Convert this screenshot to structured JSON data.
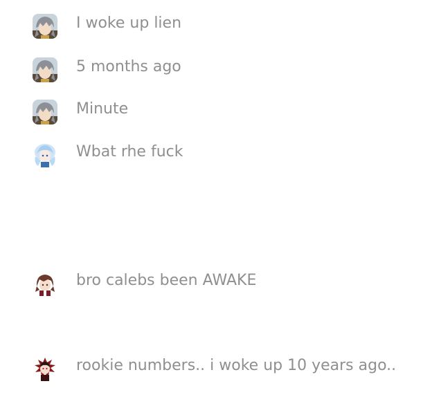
{
  "messages": [
    {
      "avatar": "gray-haired-character-avatar",
      "text": "I woke up lien"
    },
    {
      "avatar": "gray-haired-character-avatar",
      "text": "5 months ago"
    },
    {
      "avatar": "gray-haired-character-avatar",
      "text": "Minute"
    },
    {
      "avatar": "blue-character-avatar",
      "text": "Wbat rhe fuck"
    },
    {
      "avatar": "brown-haired-character-avatar",
      "text": "bro calebs been AWAKE"
    },
    {
      "avatar": "dark-red-character-avatar",
      "text": "rookie numbers.. i woke up 10 years ago.."
    }
  ]
}
